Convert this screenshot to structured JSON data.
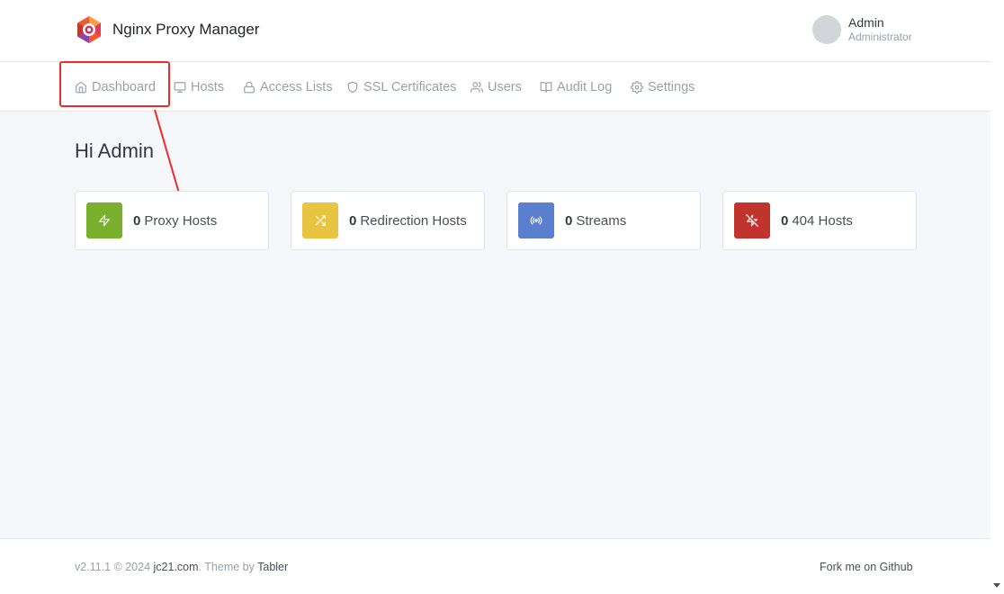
{
  "app": {
    "name": "Nginx Proxy Manager"
  },
  "user": {
    "name": "Admin",
    "role": "Administrator"
  },
  "nav": {
    "items": [
      {
        "label": "Dashboard",
        "icon": "home-icon"
      },
      {
        "label": "Hosts",
        "icon": "monitor-icon"
      },
      {
        "label": "Access Lists",
        "icon": "lock-icon"
      },
      {
        "label": "SSL Certificates",
        "icon": "shield-icon"
      },
      {
        "label": "Users",
        "icon": "users-icon"
      },
      {
        "label": "Audit Log",
        "icon": "book-icon"
      },
      {
        "label": "Settings",
        "icon": "gear-icon"
      }
    ]
  },
  "main": {
    "greeting": "Hi Admin",
    "cards": [
      {
        "count": "0",
        "label": "Proxy Hosts",
        "icon": "zap-icon",
        "color": "#7bb02f"
      },
      {
        "count": "0",
        "label": "Redirection Hosts",
        "icon": "shuffle-icon",
        "color": "#e9c441"
      },
      {
        "count": "0",
        "label": "Streams",
        "icon": "radio-icon",
        "color": "#5a7fce"
      },
      {
        "count": "0",
        "label": "404 Hosts",
        "icon": "zap-off-icon",
        "color": "#c0342d"
      }
    ]
  },
  "footer": {
    "version": "v2.11.1 © 2024",
    "site": "jc21.com",
    "theme_prefix": ". Theme by",
    "theme": "Tabler",
    "github": "Fork me on Github"
  },
  "annotation": {
    "color": "#ee2b2b"
  }
}
